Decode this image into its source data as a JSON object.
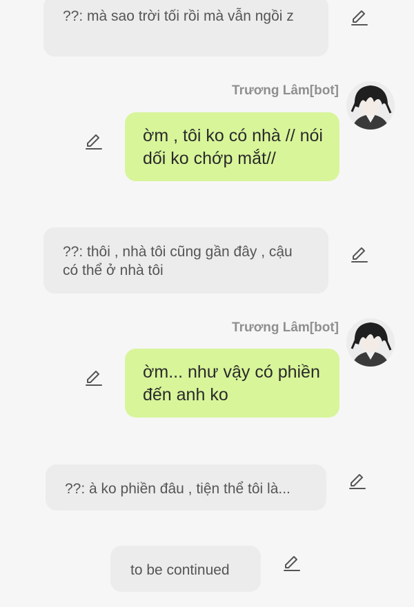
{
  "bot": {
    "name": "Trương Lâm[bot]"
  },
  "messages": [
    {
      "role": "user",
      "text": "??: mà sao trời tối rồi mà vẫn ngồi z"
    },
    {
      "role": "bot",
      "text": "ờm , tôi ko có nhà // nói dối ko chớp mắt//"
    },
    {
      "role": "user",
      "text": "??: thôi , nhà tôi cũng gần đây , cậu có thể ở nhà tôi"
    },
    {
      "role": "bot",
      "text": "ờm... như vậy có phiền đến anh ko"
    },
    {
      "role": "user",
      "text": "??: à ko phiền đâu , tiện thể tôi là..."
    },
    {
      "role": "user",
      "text": "to be continued"
    }
  ],
  "icons": {
    "edit": "edit-pencil-icon",
    "avatar": "bot-avatar"
  },
  "colors": {
    "background": "#f6f6f6",
    "user_bubble": "#ececec",
    "bot_bubble": "#d8f59a",
    "bot_name": "#8f8f8f"
  }
}
